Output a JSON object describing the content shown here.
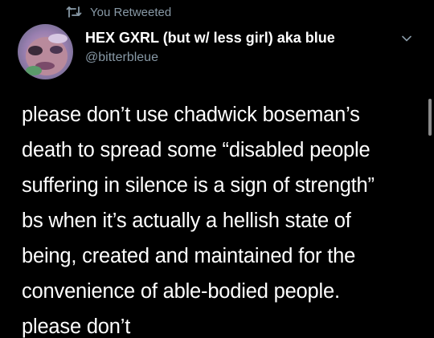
{
  "retweet_header": {
    "icon": "retweet-icon",
    "label": "You Retweeted"
  },
  "author": {
    "avatar": "avatar",
    "display_name": "HEX GXRL (but w/ less girl) aka blue",
    "handle": "@bitterbleue"
  },
  "menu": {
    "icon": "chevron-down-icon"
  },
  "tweet": {
    "lines": [
      "please don’t use chadwick boseman’s",
      "death to spread some “disabled people",
      "suffering in silence is a sign of strength”",
      "bs when it’s actually a hellish state of",
      "being, created and maintained for the",
      "convenience of able-bodied people.",
      "please don’t"
    ]
  },
  "colors": {
    "background": "#000000",
    "primary_text": "#ffffff",
    "secondary_text": "#8899a6"
  }
}
